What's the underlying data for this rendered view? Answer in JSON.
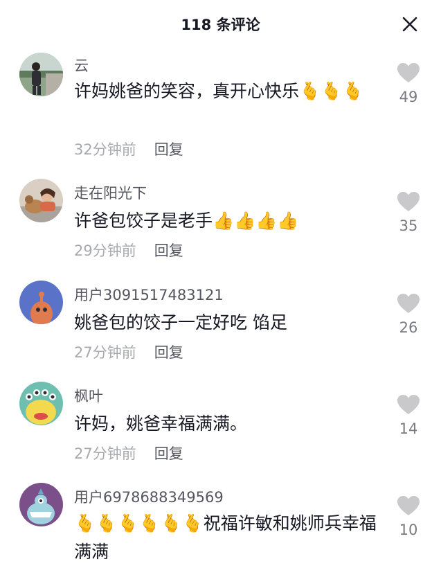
{
  "header": {
    "title": "118 条评论"
  },
  "comments": [
    {
      "username": "云",
      "text": "许妈姚爸的笑容，真开心快乐🫰🫰🫰",
      "time": "32分钟前",
      "reply_label": "回复",
      "likes": "49"
    },
    {
      "username": "走在阳光下",
      "text": "许爸包饺子是老手👍👍👍👍",
      "time": "29分钟前",
      "reply_label": "回复",
      "likes": "35"
    },
    {
      "username": "用户3091517483121",
      "text": "姚爸包的饺子一定好吃 馅足",
      "time": "27分钟前",
      "reply_label": "回复",
      "likes": "26"
    },
    {
      "username": "枫叶",
      "text": "许妈，姚爸幸福满满。",
      "time": "27分钟前",
      "reply_label": "回复",
      "likes": "14"
    },
    {
      "username": "用户6978688349569",
      "text": "🫰🫰🫰🫰🫰🫰祝福许敏和姚师兵幸福满满",
      "likes": "10"
    }
  ],
  "colors": {
    "title": "#161823",
    "username": "#555560",
    "time": "#a8a9ae",
    "reply": "#57585f",
    "heart": "#c9c9cc"
  }
}
